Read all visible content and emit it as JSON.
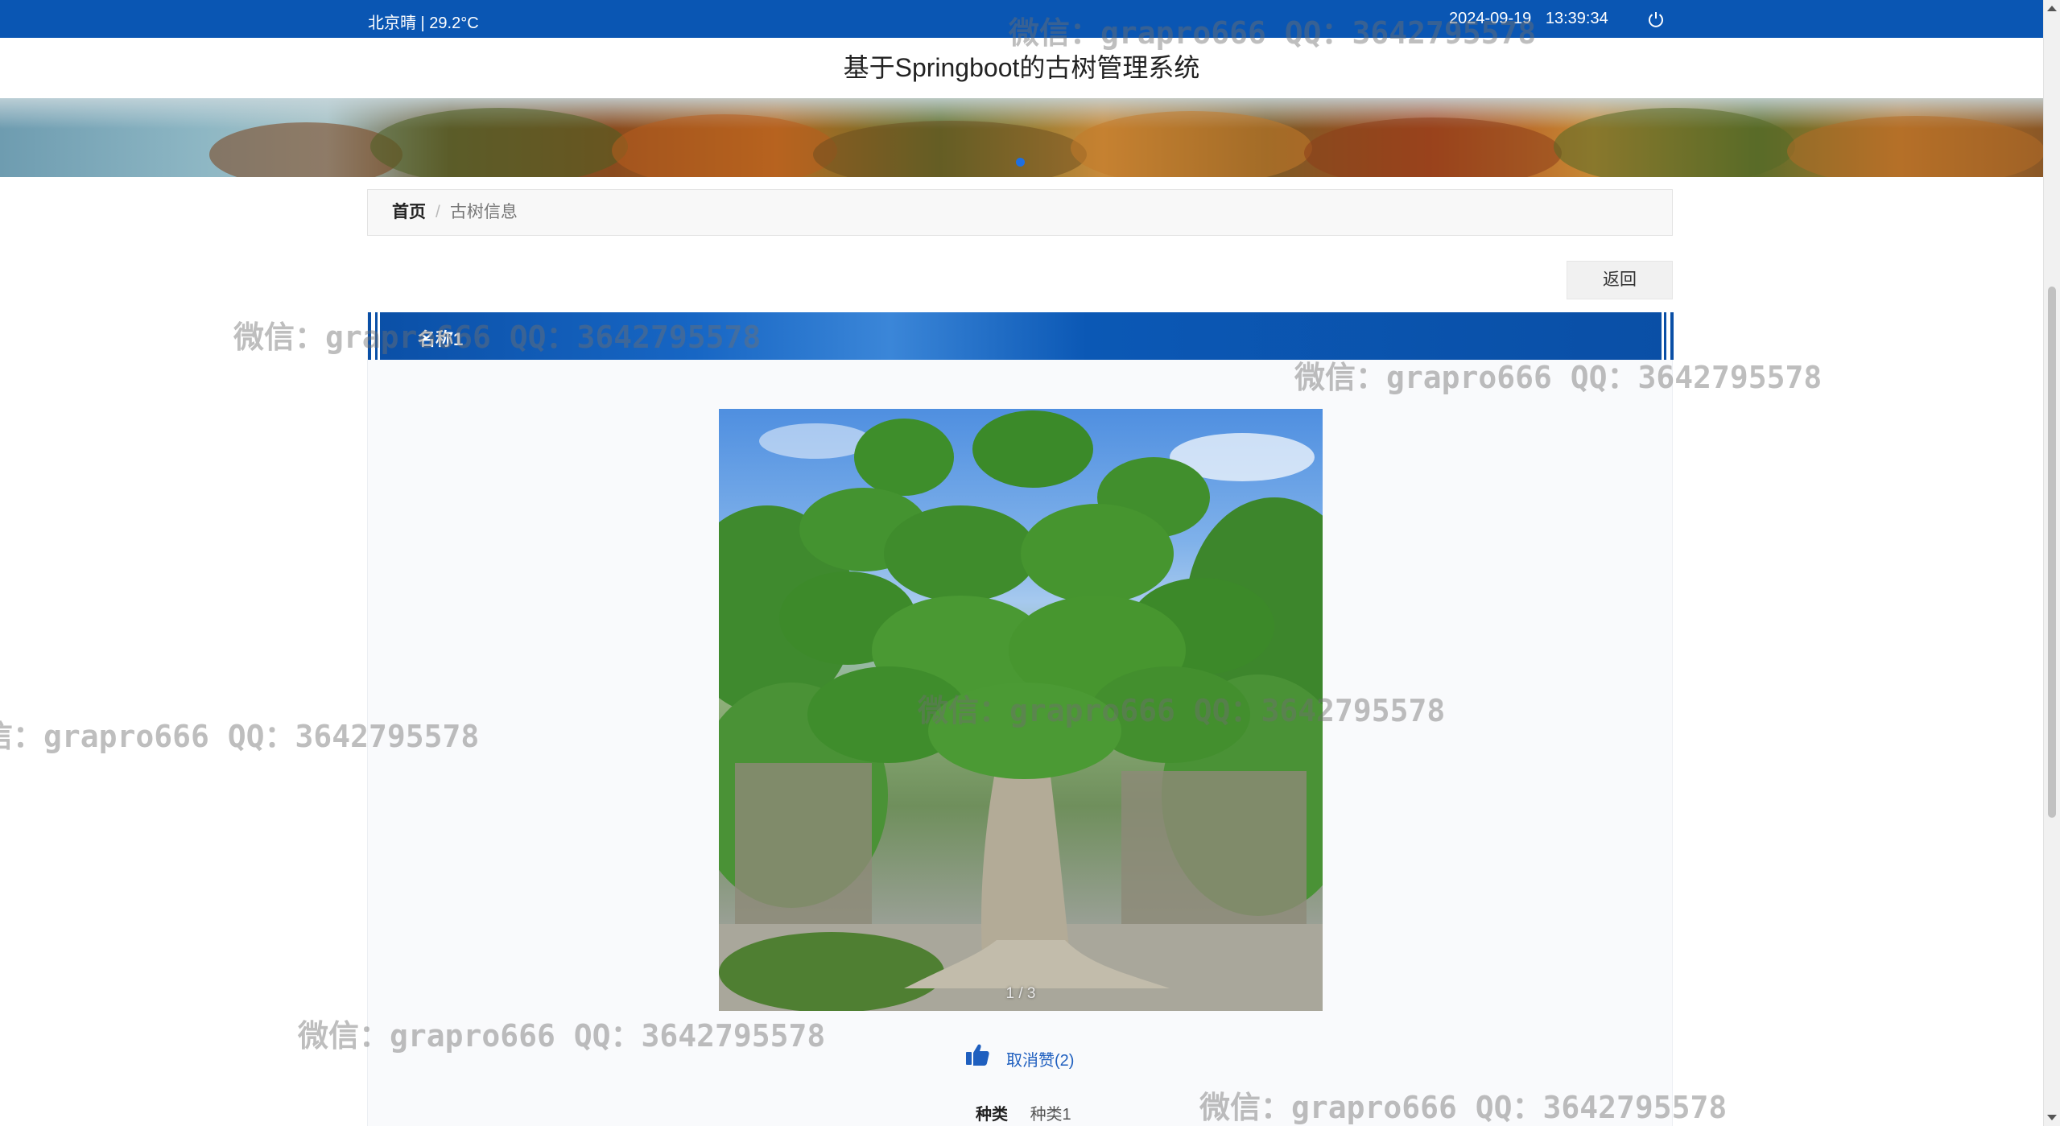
{
  "topbar": {
    "weather": "北京晴 | 29.2°C",
    "date": "2024-09-19",
    "time": "13:39:34",
    "power_icon": "power-icon"
  },
  "site_title": "基于Springboot的古树管理系统",
  "breadcrumb": {
    "home": "首页",
    "separator": "/",
    "current": "古树信息"
  },
  "actions": {
    "back_label": "返回"
  },
  "detail": {
    "name": "名称1",
    "image_counter": "1 / 3",
    "like": {
      "icon": "thumbs-up-icon",
      "label": "取消赞(2)"
    },
    "fields": [
      {
        "label": "种类",
        "value": "种类1"
      }
    ]
  },
  "watermark": {
    "text": "微信：grapro666 QQ：3642795578"
  },
  "colors": {
    "primary": "#0a56b3",
    "link": "#1f5fbf"
  }
}
